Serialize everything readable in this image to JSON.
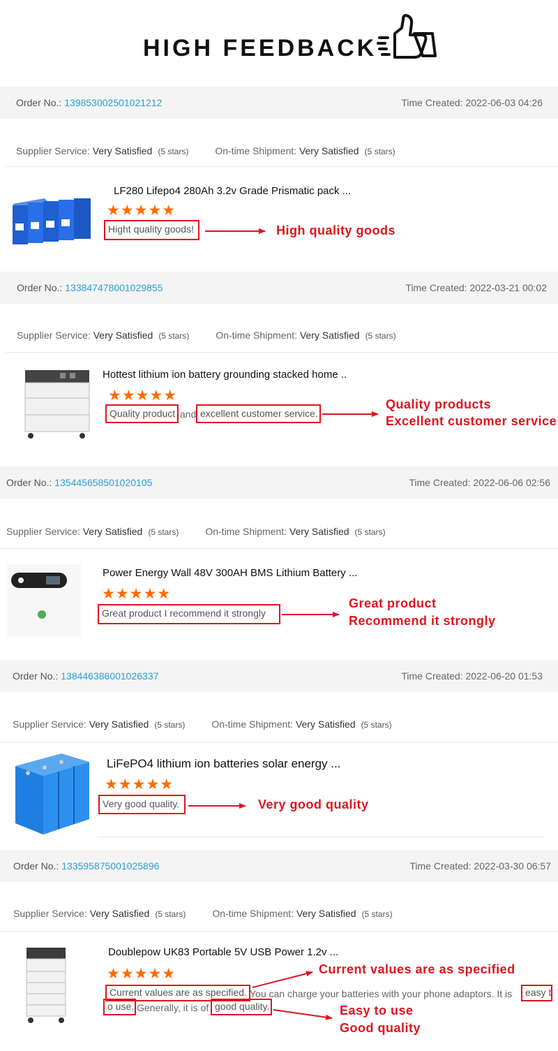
{
  "banner": {
    "title": "HIGH FEEDBACK",
    "icon": "thumbs-up-icon"
  },
  "labels": {
    "order_no": "Order No.:",
    "time_created": "Time Created:",
    "supplier_service": "Supplier Service:",
    "ontime_shipment": "On-time Shipment:"
  },
  "colors": {
    "accent_red": "#e0141e",
    "star_orange": "#ff6a00",
    "link_blue": "#2a9fd6"
  },
  "reviews": [
    {
      "order_no": "139853002501021212",
      "time": "2022-06-03 04:26",
      "supplier_value": "Very Satisfied",
      "supplier_stars": "(5 stars)",
      "shipment_value": "Very Satisfied",
      "shipment_stars": "(5 stars)",
      "product_name": "LF280 Lifepo4 280Ah 3.2v Grade Prismatic pack ...",
      "stars": "★★★★★",
      "comment": "Hight quality goods!",
      "annotation": "High quality goods"
    },
    {
      "order_no": "133847478001029855",
      "time": "2022-03-21 00:02",
      "supplier_value": "Very Satisfied",
      "supplier_stars": "(5 stars)",
      "shipment_value": "Very Satisfied",
      "shipment_stars": "(5 stars)",
      "product_name": "Hottest lithium ion battery grounding stacked home ..",
      "stars": "★★★★★",
      "comment_part1": "Quality product",
      "comment_joiner": "and",
      "comment_part2": "excellent customer service.",
      "annotation_line1": "Quality products",
      "annotation_line2": "Excellent customer service"
    },
    {
      "order_no": "135445658501020105",
      "time": "2022-06-06 02:56",
      "supplier_value": "Very Satisfied",
      "supplier_stars": "(5 stars)",
      "shipment_value": "Very Satisfied",
      "shipment_stars": "(5 stars)",
      "product_name": "Power Energy Wall 48V 300AH BMS Lithium Battery ...",
      "stars": "★★★★★",
      "comment": "Great product I recommend it strongly",
      "annotation_line1": "Great product",
      "annotation_line2": "Recommend it strongly"
    },
    {
      "order_no": "138446386001026337",
      "time": "2022-06-20 01:53",
      "supplier_value": "Very Satisfied",
      "supplier_stars": "(5 stars)",
      "shipment_value": "Very Satisfied",
      "shipment_stars": "(5 stars)",
      "product_name": "LiFePO4 lithium ion batteries solar energy ...",
      "stars": "★★★★★",
      "comment": "Very good quality.",
      "annotation": "Very good quality"
    },
    {
      "order_no": "133595875001025896",
      "time": "2022-03-30 06:57",
      "supplier_value": "Very Satisfied",
      "supplier_stars": "(5 stars)",
      "shipment_value": "Very Satisfied",
      "shipment_stars": "(5 stars)",
      "product_name": "Doublepow UK83 Portable 5V USB Power 1.2v ...",
      "stars": "★★★★★",
      "comment_a": "Current values are as specified.",
      "comment_b": " You can charge your batteries with your phone adaptors. It is ",
      "comment_c": "easy t",
      "comment_d": "o use.",
      "comment_e": " Generally, it is of ",
      "comment_f": "good quality.",
      "annotation_top": "Current values are as specified",
      "annotation_line1": "Easy to use",
      "annotation_line2": "Good quality"
    }
  ]
}
